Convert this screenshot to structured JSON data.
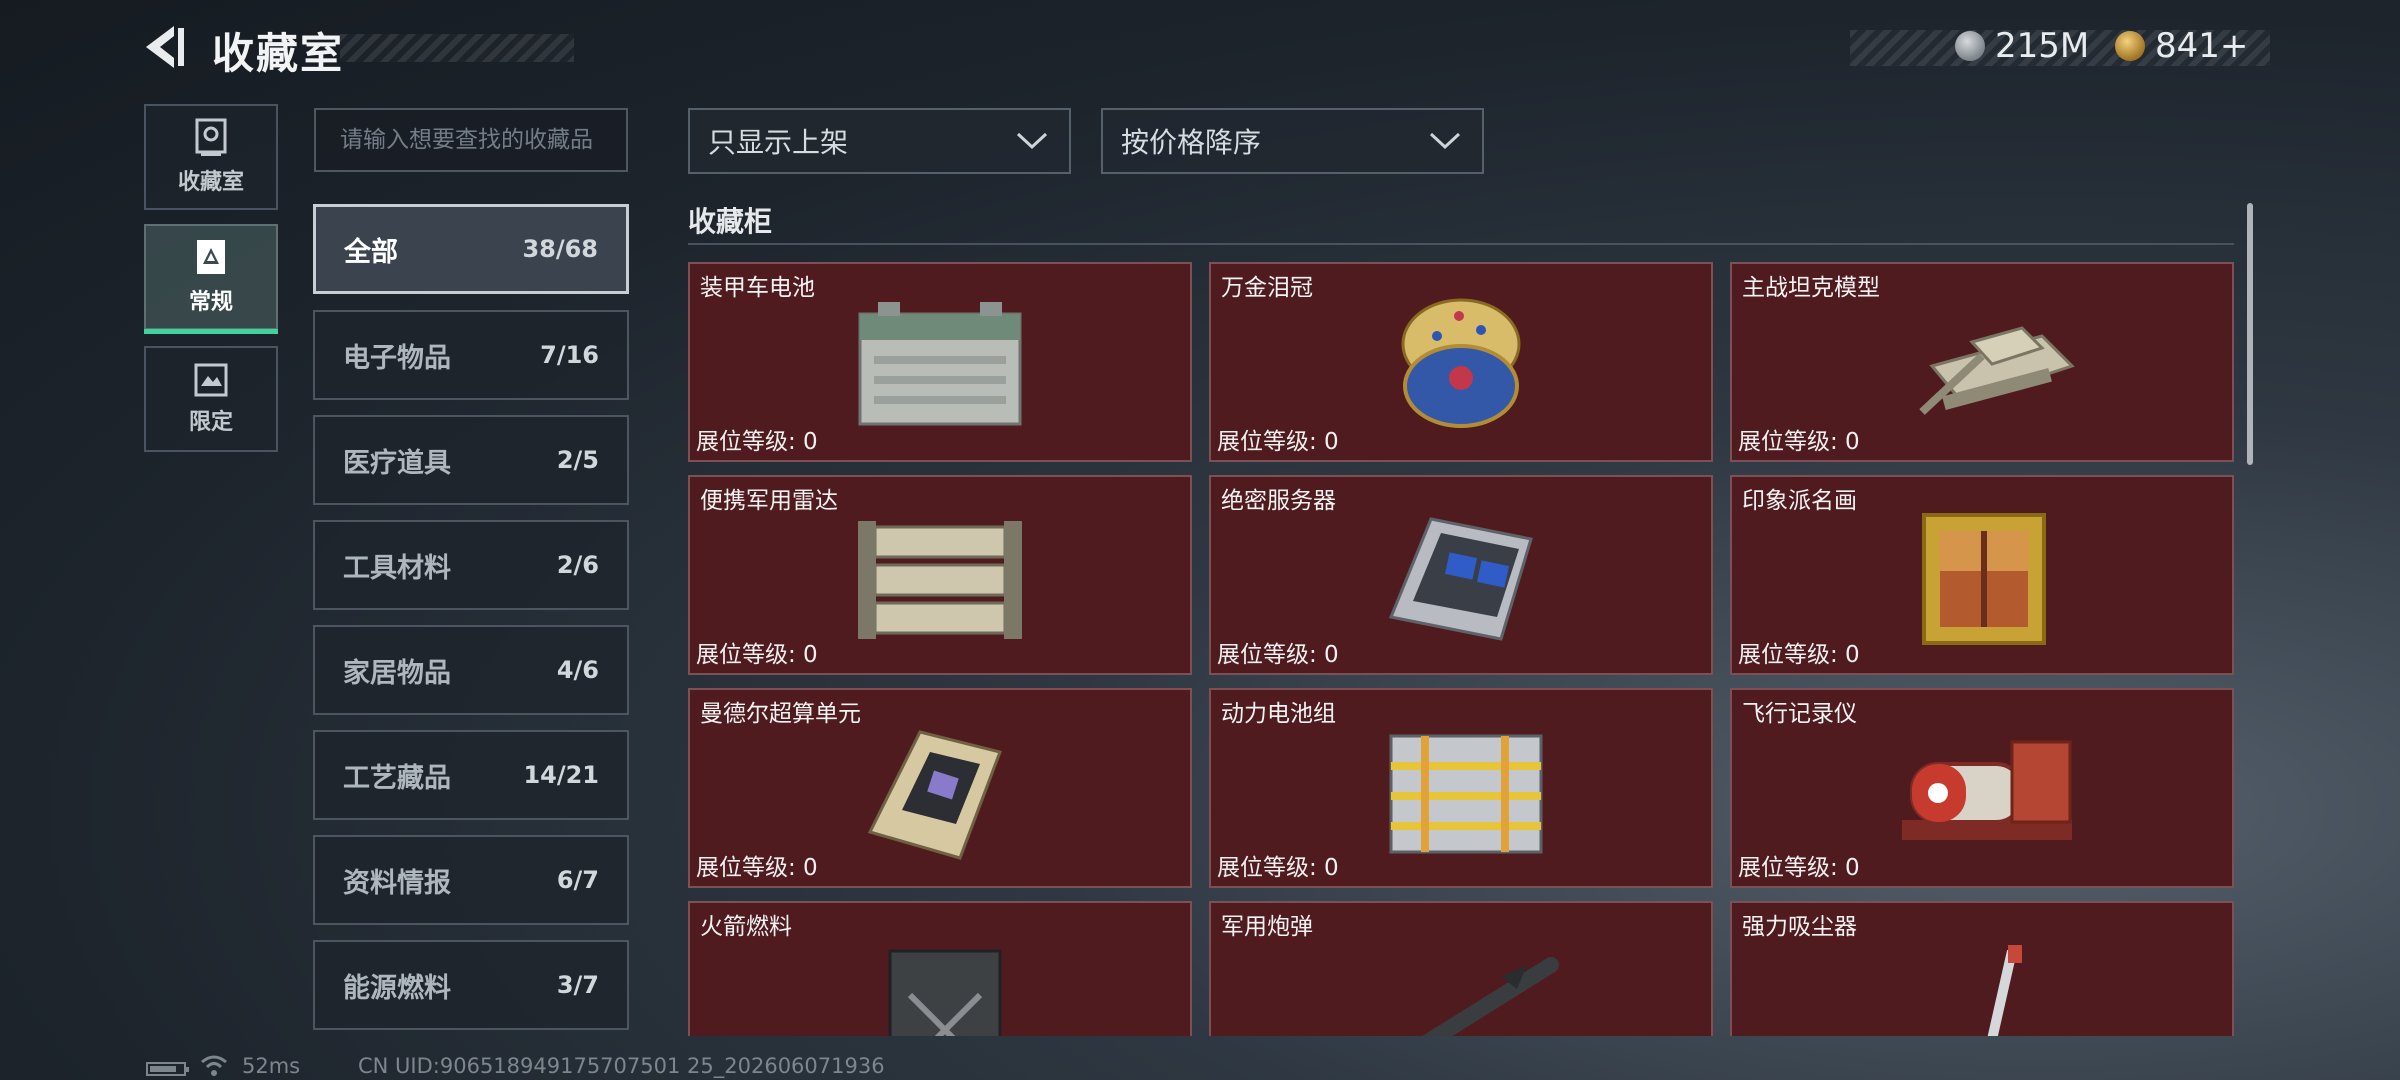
{
  "header": {
    "title": "收藏室"
  },
  "currency": [
    {
      "icon": "silver-coin-icon",
      "value": "215M"
    },
    {
      "icon": "gold-coin-icon",
      "value": "841+"
    }
  ],
  "left_tabs": [
    {
      "label": "收藏室",
      "icon": "collection-room-icon",
      "active": false
    },
    {
      "label": "常规",
      "icon": "regular-icon",
      "active": true
    },
    {
      "label": "限定",
      "icon": "limited-icon",
      "active": false
    }
  ],
  "search": {
    "placeholder": "请输入想要查找的收藏品",
    "value": ""
  },
  "categories": [
    {
      "name": "全部",
      "count": "38/68",
      "active": true
    },
    {
      "name": "电子物品",
      "count": "7/16"
    },
    {
      "name": "医疗道具",
      "count": "2/5"
    },
    {
      "name": "工具材料",
      "count": "2/6"
    },
    {
      "name": "家居物品",
      "count": "4/6"
    },
    {
      "name": "工艺藏品",
      "count": "14/21"
    },
    {
      "name": "资料情报",
      "count": "6/7"
    },
    {
      "name": "能源燃料",
      "count": "3/7"
    }
  ],
  "filters": {
    "display": "只显示上架",
    "sort": "按价格降序"
  },
  "section": {
    "title": "收藏柜"
  },
  "items": [
    {
      "name": "装甲车电池",
      "level": "展位等级: 0",
      "icon": "car-battery-icon"
    },
    {
      "name": "万金泪冠",
      "level": "展位等级: 0",
      "icon": "jeweled-egg-icon"
    },
    {
      "name": "主战坦克模型",
      "level": "展位等级: 0",
      "icon": "tank-model-icon"
    },
    {
      "name": "便携军用雷达",
      "level": "展位等级: 0",
      "icon": "radar-icon"
    },
    {
      "name": "绝密服务器",
      "level": "展位等级: 0",
      "icon": "server-icon"
    },
    {
      "name": "印象派名画",
      "level": "展位等级: 0",
      "icon": "painting-icon"
    },
    {
      "name": "曼德尔超算单元",
      "level": "展位等级: 0",
      "icon": "computing-unit-icon"
    },
    {
      "name": "动力电池组",
      "level": "展位等级: 0",
      "icon": "battery-pack-icon"
    },
    {
      "name": "飞行记录仪",
      "level": "展位等级: 0",
      "icon": "flight-recorder-icon"
    },
    {
      "name": "火箭燃料",
      "level": "",
      "icon": "fuel-can-icon"
    },
    {
      "name": "军用炮弹",
      "level": "",
      "icon": "shell-icon"
    },
    {
      "name": "强力吸尘器",
      "level": "",
      "icon": "vacuum-icon"
    }
  ],
  "footer": {
    "ping": "52ms",
    "uid": "CN UID:906518949175707501 25_202606071936"
  }
}
